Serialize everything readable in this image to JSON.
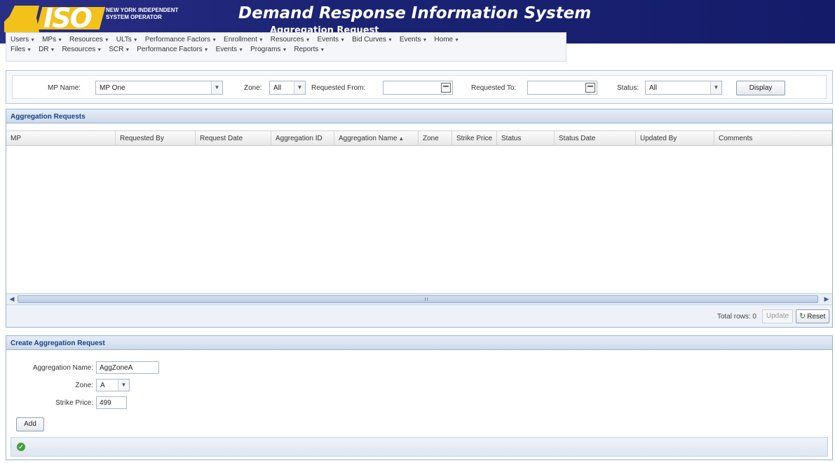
{
  "header": {
    "org": "NEW YORK INDEPENDENT SYSTEM OPERATOR",
    "logo_text": "ISO",
    "app_title": "Demand Response Information System",
    "page_subtitle": "Aggregation Request"
  },
  "menu": {
    "row1": [
      "Users",
      "MPs",
      "Resources",
      "ULTs",
      "Performance Factors",
      "Enrollment",
      "Resources",
      "Events",
      "Bid Curves",
      "Events",
      "Home"
    ],
    "row2": [
      "Files",
      "DR",
      "Resources",
      "SCR",
      "Performance Factors",
      "Events",
      "Programs",
      "Reports"
    ]
  },
  "filters": {
    "mp_name_label": "MP Name:",
    "mp_name_value": "MP One",
    "zone_label": "Zone:",
    "zone_value": "All",
    "requested_from_label": "Requested From:",
    "requested_to_label": "Requested To:",
    "status_label": "Status:",
    "status_value": "All",
    "display_button": "Display"
  },
  "grid": {
    "title": "Aggregation Requests",
    "columns": [
      "MP",
      "Requested By",
      "Request Date",
      "Aggregation ID",
      "Aggregation Name",
      "Zone",
      "Strike Price",
      "Status",
      "Status Date",
      "Updated By",
      "Comments"
    ],
    "sorted_column_index": 4,
    "rows": [],
    "total_label": "Total rows: 0",
    "update_button": "Update",
    "reset_button": "Reset"
  },
  "create": {
    "title": "Create Aggregation Request",
    "name_label": "Aggregation Name:",
    "name_value": "AggZoneA",
    "zone_label": "Zone:",
    "zone_value": "A",
    "strike_label": "Strike Price:",
    "strike_value": "499",
    "add_button": "Add"
  },
  "colors": {
    "header_bg": "#1b2374",
    "logo_yellow": "#f2c21b",
    "panel_title_text": "#15428b",
    "ok_green": "#3da13d"
  }
}
